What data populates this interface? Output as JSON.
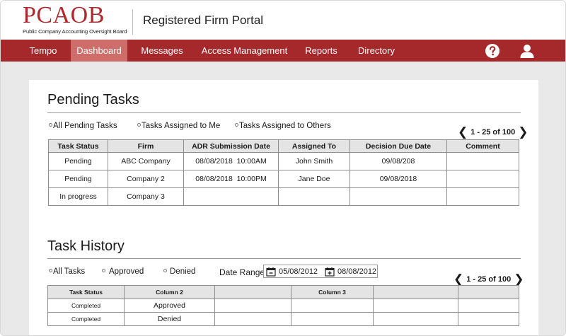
{
  "brand": {
    "logo_text": "PCAOB",
    "logo_subtitle": "Public Company Accounting Oversight Board",
    "portal_title": "Registered Firm Portal",
    "accent_color": "#a5282b",
    "active_tab_color": "#cf6d6b"
  },
  "nav": {
    "items": [
      {
        "label": "Tempo"
      },
      {
        "label": "Dashboard",
        "active": true
      },
      {
        "label": "Messages"
      },
      {
        "label": "Access Management"
      },
      {
        "label": "Reports"
      },
      {
        "label": "Directory"
      }
    ],
    "help_icon": "help-circle-icon",
    "user_icon": "user-icon"
  },
  "pending": {
    "title": "Pending Tasks",
    "filters": [
      {
        "label": "All Pending Tasks"
      },
      {
        "label": "Tasks Assigned to Me"
      },
      {
        "label": "Tasks Assigned to Others"
      }
    ],
    "pager_text": "1 - 25 of 100",
    "columns": [
      "Task Status",
      "Firm",
      "ADR Submission Date",
      "Assigned To",
      "Decision Due Date",
      "Comment"
    ],
    "rows": [
      [
        "Pending",
        "ABC Company",
        "08/08/2018  10:00AM",
        "John Smith",
        "09/08/208",
        ""
      ],
      [
        "Pending",
        "Company 2",
        "08/08/2018  10:00PM",
        "Jane Doe",
        "09/08/2018",
        ""
      ],
      [
        "In progress",
        "Company 3",
        "",
        "",
        "",
        ""
      ]
    ]
  },
  "history": {
    "title": "Task History",
    "filters": [
      {
        "label": "All Tasks"
      },
      {
        "label": "Approved"
      },
      {
        "label": "Denied"
      }
    ],
    "date_range_label": "Date Range",
    "date_from": "05/08/2012",
    "date_to": "08/08/2012",
    "pager_text": "1 - 25 of 100",
    "columns": [
      "Task Status",
      "Column 2",
      "",
      "Column 3",
      "",
      ""
    ],
    "rows": [
      [
        "Completed",
        "Approved",
        "",
        "",
        "",
        ""
      ],
      [
        "Completed",
        "Denied",
        "",
        "",
        "",
        ""
      ]
    ],
    "status_colors": {
      "Approved": "#2e7d32",
      "Denied": "#d32f2f"
    }
  }
}
